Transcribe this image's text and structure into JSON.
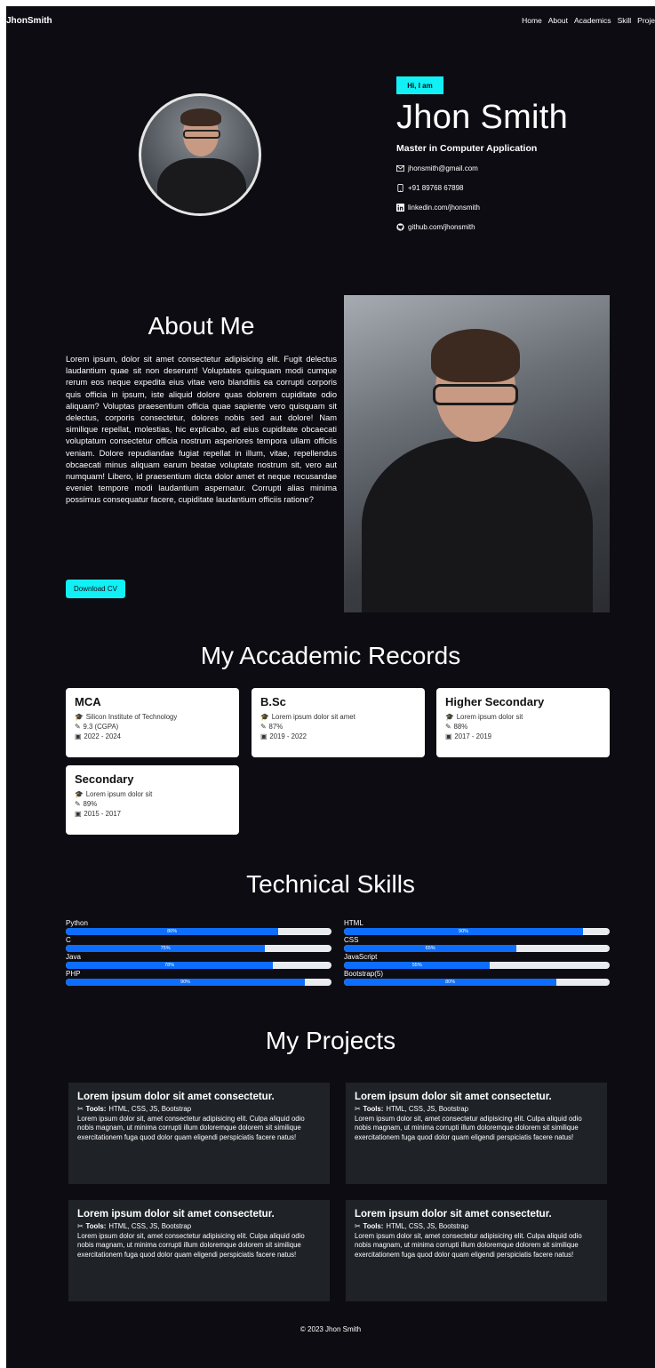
{
  "nav": {
    "brand": "JhonSmith",
    "links": [
      "Home",
      "About",
      "Academics",
      "Skill",
      "Proje"
    ]
  },
  "hero": {
    "badge": "Hi, I am",
    "name": "Jhon Smith",
    "degree": "Master in Computer Application",
    "contacts": [
      {
        "icon": "mail-icon",
        "text": "jhonsmith@gmail.com"
      },
      {
        "icon": "phone-icon",
        "text": "+91 89768 67898"
      },
      {
        "icon": "linkedin-icon",
        "text": "linkedin.com/jhonsmith"
      },
      {
        "icon": "github-icon",
        "text": "github.com/jhonsmith"
      }
    ]
  },
  "about": {
    "title": "About Me",
    "text": "Lorem ipsum, dolor sit amet consectetur adipisicing elit. Fugit delectus laudantium quae sit non deserunt! Voluptates quisquam modi cumque rerum eos neque expedita eius vitae vero blanditiis ea corrupti corporis quis officia in ipsum, iste aliquid dolore quas dolorem cupiditate odio aliquam? Voluptas praesentium officia quae sapiente vero quisquam sit delectus, corporis consectetur, dolores nobis sed aut dolore! Nam similique repellat, molestias, hic explicabo, ad eius cupiditate obcaecati voluptatum consectetur officia nostrum asperiores tempora ullam officiis veniam. Dolore repudiandae fugiat repellat in illum, vitae, repellendus obcaecati minus aliquam earum beatae voluptate nostrum sit, vero aut numquam! Libero, id praesentium dicta dolor amet et neque recusandae eveniet tempore modi laudantium aspernatur. Corrupti alias minima possimus consequatur facere, cupiditate laudantium officiis ratione?",
    "cv_button": "Download CV"
  },
  "academics": {
    "title": "My Accademic Records",
    "records": [
      {
        "degree": "MCA",
        "institute": "Silicon Institute of Technology",
        "score": "9.3 (CGPA)",
        "years": "2022 - 2024"
      },
      {
        "degree": "B.Sc",
        "institute": "Lorem ipsum dolor sit amet",
        "score": "87%",
        "years": "2019 - 2022"
      },
      {
        "degree": "Higher Secondary",
        "institute": "Lorem ipsum dolor sit",
        "score": "88%",
        "years": "2017 - 2019"
      },
      {
        "degree": "Secondary",
        "institute": "Lorem ipsum dolor sit",
        "score": "89%",
        "years": "2015 - 2017"
      }
    ]
  },
  "skills": {
    "title": "Technical Skills",
    "items": [
      {
        "name": "Python",
        "percent": 80,
        "label": "80%"
      },
      {
        "name": "HTML",
        "percent": 90,
        "label": "90%"
      },
      {
        "name": "C",
        "percent": 75,
        "label": "75%"
      },
      {
        "name": "CSS",
        "percent": 65,
        "label": "65%"
      },
      {
        "name": "Java",
        "percent": 78,
        "label": "78%"
      },
      {
        "name": "JavaScript",
        "percent": 55,
        "label": "55%"
      },
      {
        "name": "PHP",
        "percent": 90,
        "label": "90%"
      },
      {
        "name": "Bootstrap(5)",
        "percent": 80,
        "label": "80%"
      }
    ],
    "fill_color": "#0d6efd",
    "track_color": "#e9ecef"
  },
  "projects": {
    "title": "My Projects",
    "items": [
      {
        "title": "Lorem ipsum dolor sit amet consectetur.",
        "tools_label": "Tools:",
        "tools": "HTML, CSS, JS, Bootstrap",
        "desc": "Lorem ipsum dolor sit, amet consectetur adipisicing elit. Culpa aliquid odio nobis magnam, ut minima corrupti illum doloremque dolorem sit similique exercitationem fuga quod dolor quam eligendi perspiciatis facere natus!"
      },
      {
        "title": "Lorem ipsum dolor sit amet consectetur.",
        "tools_label": "Tools:",
        "tools": "HTML, CSS, JS, Bootstrap",
        "desc": "Lorem ipsum dolor sit, amet consectetur adipisicing elit. Culpa aliquid odio nobis magnam, ut minima corrupti illum doloremque dolorem sit similique exercitationem fuga quod dolor quam eligendi perspiciatis facere natus!"
      },
      {
        "title": "Lorem ipsum dolor sit amet consectetur.",
        "tools_label": "Tools:",
        "tools": "HTML, CSS, JS, Bootstrap",
        "desc": "Lorem ipsum dolor sit, amet consectetur adipisicing elit. Culpa aliquid odio nobis magnam, ut minima corrupti illum doloremque dolorem sit similique exercitationem fuga quod dolor quam eligendi perspiciatis facere natus!"
      },
      {
        "title": "Lorem ipsum dolor sit amet consectetur.",
        "tools_label": "Tools:",
        "tools": "HTML, CSS, JS, Bootstrap",
        "desc": "Lorem ipsum dolor sit, amet consectetur adipisicing elit. Culpa aliquid odio nobis magnam, ut minima corrupti illum doloremque dolorem sit similique exercitationem fuga quod dolor quam eligendi perspiciatis facere natus!"
      }
    ]
  },
  "footer": {
    "text": "© 2023 Jhon Smith"
  },
  "colors": {
    "accent": "#10f0f5",
    "background": "#0d0c12",
    "card": "#1f2227"
  }
}
